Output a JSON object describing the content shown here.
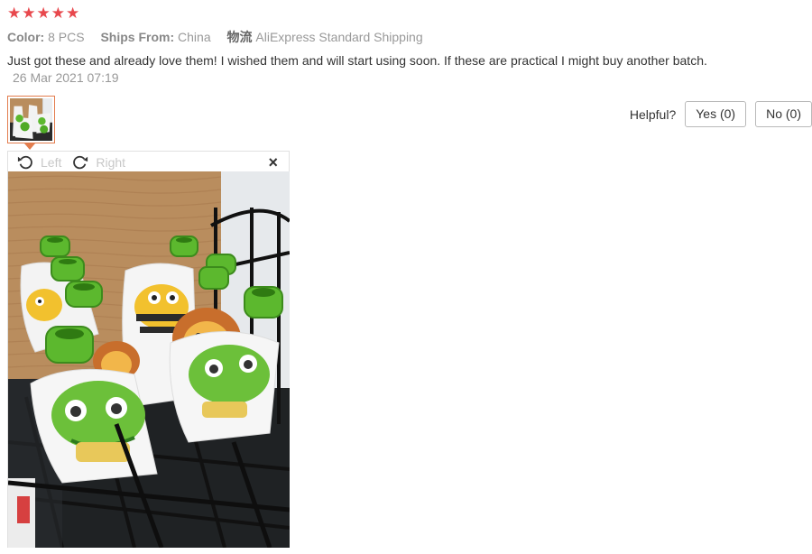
{
  "rating": {
    "stars": 5,
    "star_glyph": "★",
    "color": "#e8484d"
  },
  "meta": {
    "color_key": "Color:",
    "color_value": "8 PCS",
    "ships_key": "Ships From:",
    "ships_value": "China",
    "logistics_icon": "物流",
    "logistics_value": "AliExpress Standard Shipping"
  },
  "review": {
    "text": "Just got these and already love them! I wished them and will start using soon. If these are practical I might buy another batch.",
    "date": "26 Mar 2021 07:19"
  },
  "helpful": {
    "label": "Helpful?",
    "yes_label": "Yes (0)",
    "no_label": "No (0)"
  },
  "viewer": {
    "rotate_left_label": "Left",
    "rotate_right_label": "Right",
    "close_glyph": "×"
  },
  "colors": {
    "accent": "#e37d4e",
    "pouch_green": "#5cb82e"
  }
}
